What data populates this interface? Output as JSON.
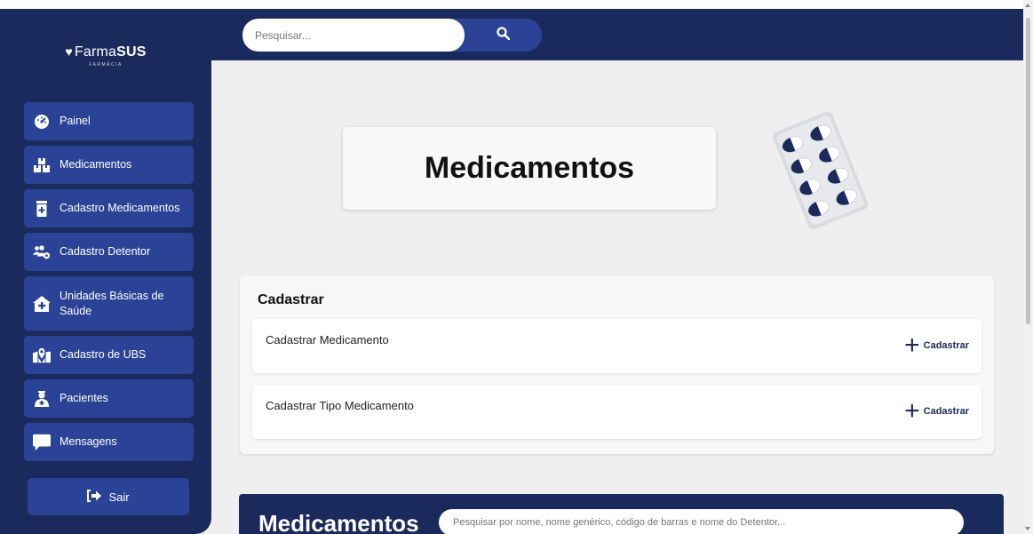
{
  "brand": {
    "name_light": "Farma",
    "name_bold": "SUS",
    "subtitle": "FARMÁCIA"
  },
  "search": {
    "placeholder": "Pesquisar..."
  },
  "sidebar": {
    "items": [
      {
        "label": "Painel",
        "icon": "dashboard-icon"
      },
      {
        "label": "Medicamentos",
        "icon": "boxes-icon"
      },
      {
        "label": "Cadastro Medicamentos",
        "icon": "medicine-bottle-icon"
      },
      {
        "label": "Cadastro Detentor",
        "icon": "users-gear-icon"
      },
      {
        "label": "Unidades Básicas de Saúde",
        "icon": "house-medical-icon"
      },
      {
        "label": "Cadastro de UBS",
        "icon": "map-location-icon"
      },
      {
        "label": "Pacientes",
        "icon": "user-doctor-icon"
      },
      {
        "label": "Mensagens",
        "icon": "message-icon"
      }
    ],
    "logout_label": "Sair"
  },
  "hero": {
    "title": "Medicamentos"
  },
  "cadastrar": {
    "title": "Cadastrar",
    "rows": [
      {
        "label": "Cadastrar Medicamento",
        "action": "Cadastrar"
      },
      {
        "label": "Cadastrar Tipo Medicamento",
        "action": "Cadastrar"
      }
    ]
  },
  "list_section": {
    "title": "Medicamentos",
    "search_placeholder": "Pesquisar por nome, nome genérico, código de barras e nome do Detentor..."
  },
  "colors": {
    "navy": "#1b2a5c",
    "button_blue": "#2a4396",
    "background": "#efefef"
  }
}
